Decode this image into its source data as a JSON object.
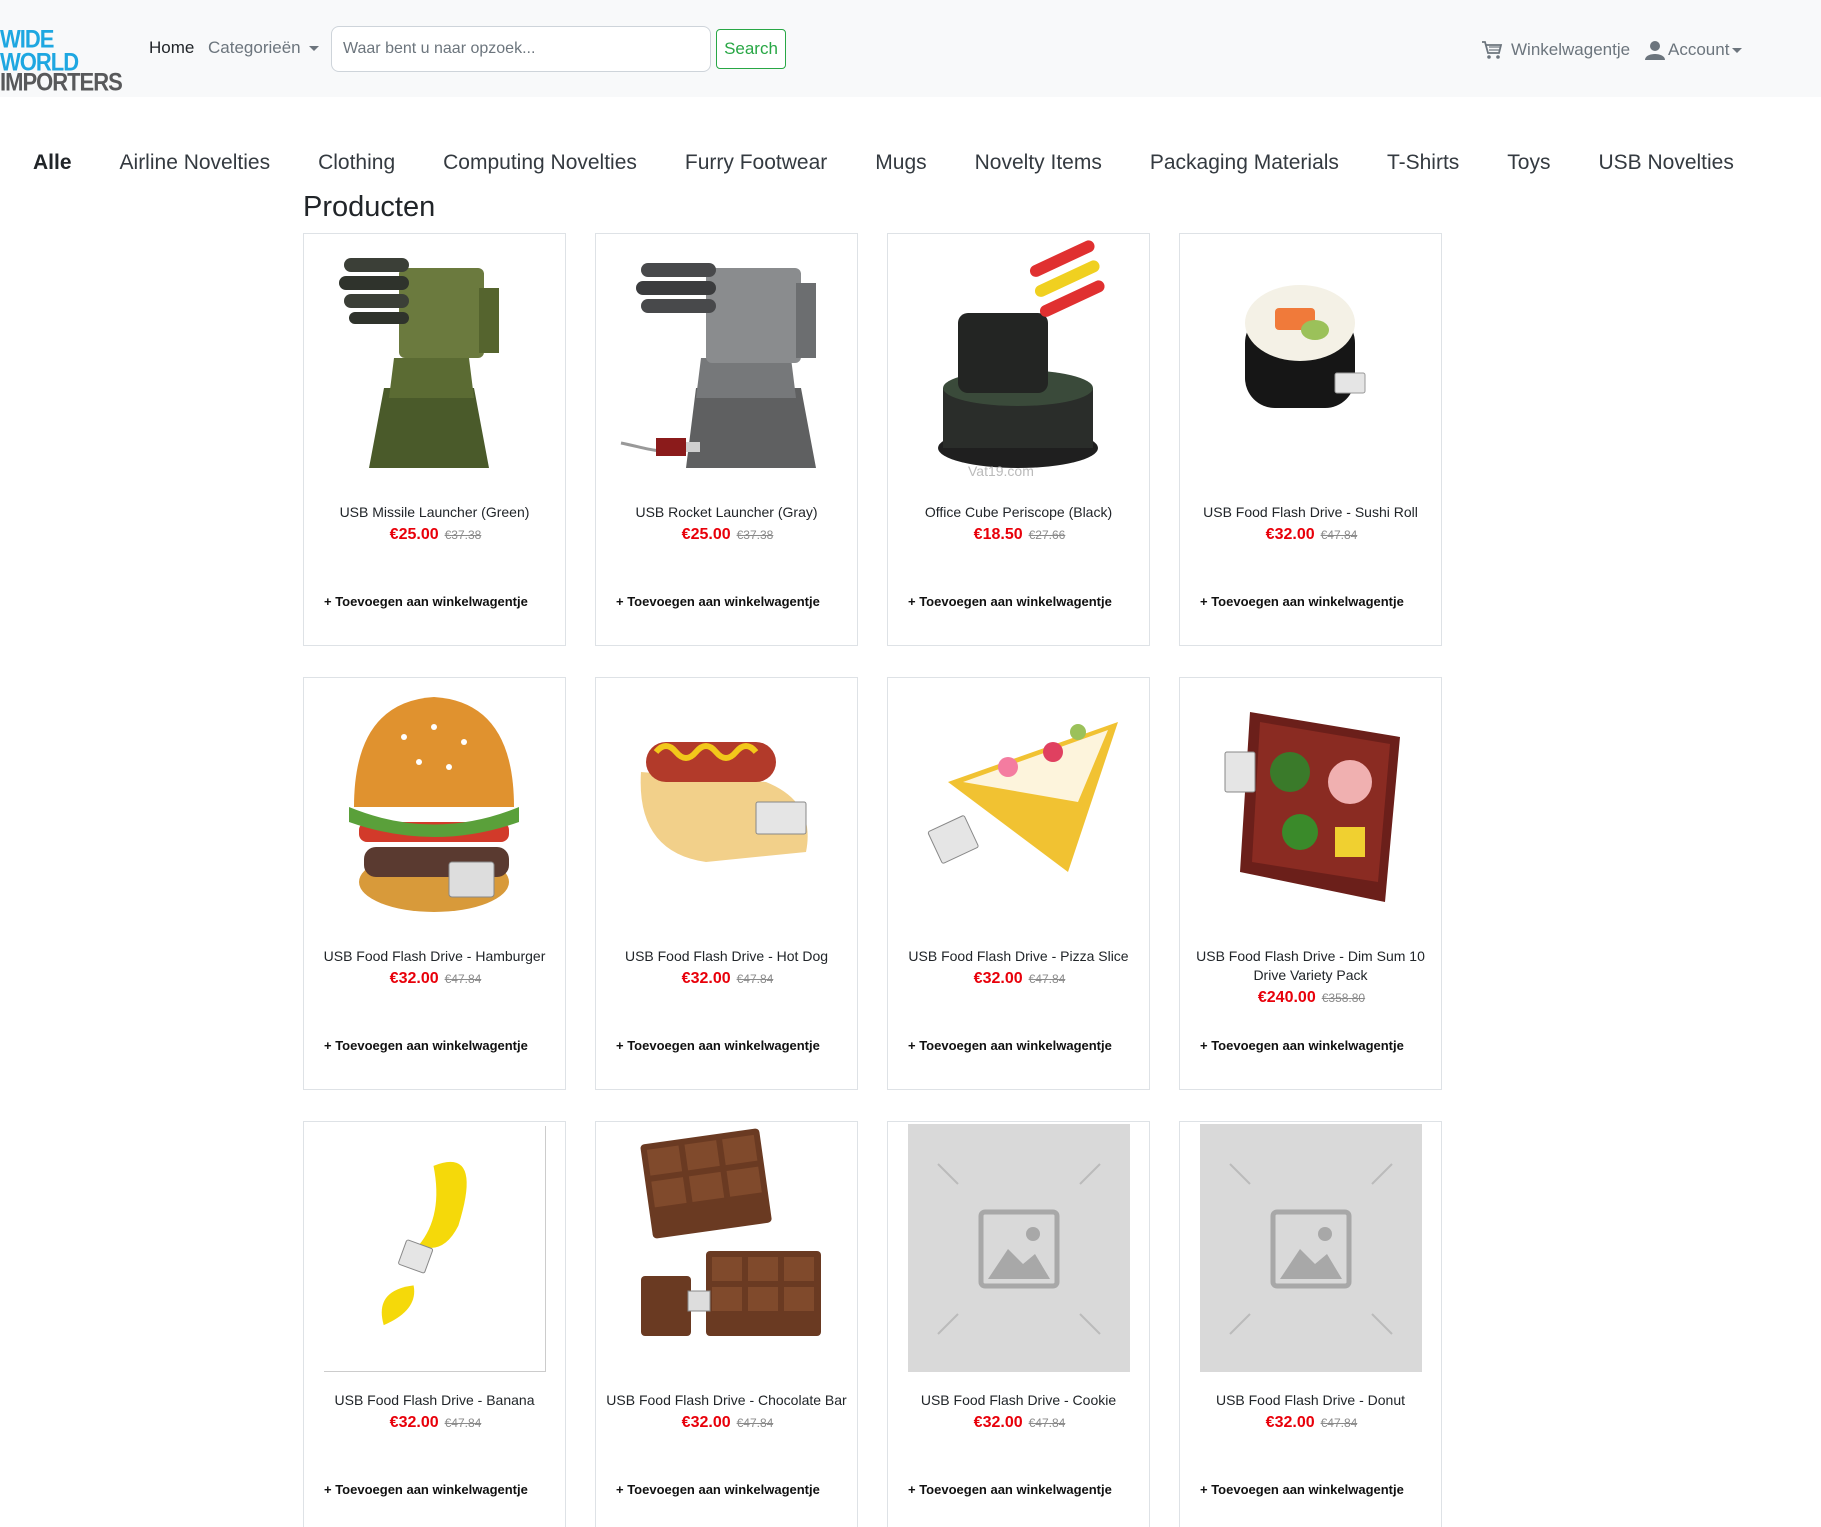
{
  "brand": {
    "line1": "WIDE WORLD",
    "line2": "IMPORTERS"
  },
  "nav": {
    "home": "Home",
    "categories": "Categorieën",
    "search_placeholder": "Waar bent u naar opzoek...",
    "search_button": "Search",
    "cart": "Winkelwagentje",
    "account": "Account"
  },
  "category_tabs": [
    "Alle",
    "Airline Novelties",
    "Clothing",
    "Computing Novelties",
    "Furry Footwear",
    "Mugs",
    "Novelty Items",
    "Packaging Materials",
    "T-Shirts",
    "Toys",
    "USB Novelties"
  ],
  "active_tab": "Alle",
  "page_title": "Producten",
  "add_to_cart_label": "+ Toevoegen aan winkelwagentje",
  "colors": {
    "price": "#e8000a",
    "accent_green": "#28a745",
    "logo_blue": "#1ea7e1",
    "logo_gray": "#58595b"
  },
  "products": [
    {
      "name": "USB Missile Launcher (Green)",
      "price": "€25.00",
      "old_price": "€37.38",
      "image": "green-missile-launcher"
    },
    {
      "name": "USB Rocket Launcher (Gray)",
      "price": "€25.00",
      "old_price": "€37.38",
      "image": "gray-rocket-launcher"
    },
    {
      "name": "Office Cube Periscope (Black)",
      "price": "€18.50",
      "old_price": "€27.66",
      "image": "black-periscope-launcher"
    },
    {
      "name": "USB Food Flash Drive - Sushi Roll",
      "price": "€32.00",
      "old_price": "€47.84",
      "image": "sushi-roll"
    },
    {
      "name": "USB Food Flash Drive - Hamburger",
      "price": "€32.00",
      "old_price": "€47.84",
      "image": "hamburger"
    },
    {
      "name": "USB Food Flash Drive - Hot Dog",
      "price": "€32.00",
      "old_price": "€47.84",
      "image": "hot-dog"
    },
    {
      "name": "USB Food Flash Drive - Pizza Slice",
      "price": "€32.00",
      "old_price": "€47.84",
      "image": "pizza-slice"
    },
    {
      "name": "USB Food Flash Drive - Dim Sum 10 Drive Variety Pack",
      "price": "€240.00",
      "old_price": "€358.80",
      "image": "bento-box"
    },
    {
      "name": "USB Food Flash Drive - Banana",
      "price": "€32.00",
      "old_price": "€47.84",
      "image": "banana"
    },
    {
      "name": "USB Food Flash Drive - Chocolate Bar",
      "price": "€32.00",
      "old_price": "€47.84",
      "image": "chocolate-bar"
    },
    {
      "name": "USB Food Flash Drive - Cookie",
      "price": "€32.00",
      "old_price": "€47.84",
      "image": "placeholder"
    },
    {
      "name": "USB Food Flash Drive - Donut",
      "price": "€32.00",
      "old_price": "€47.84",
      "image": "placeholder"
    }
  ]
}
